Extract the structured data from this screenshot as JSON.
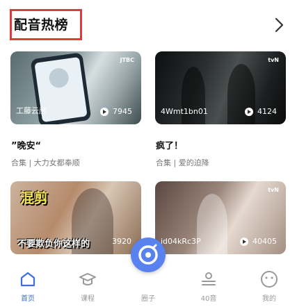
{
  "section": {
    "title": "配音热榜"
  },
  "cards": [
    {
      "label": "工藤云彦",
      "count": "7945",
      "tag": "JTBC",
      "name": "”晚安“",
      "sub": "合集 | 大力女都奉顺"
    },
    {
      "label": "4Wmt1bn01",
      "count": "4124",
      "tag": "tvN",
      "name": "疯了！",
      "sub": "合集 | 爱的迫降"
    },
    {
      "label": "",
      "count": "3920",
      "overlay_top": "混剪",
      "overlay_bottom": "不要欺负你这样的",
      "tag": ""
    },
    {
      "label": "id04kRc3P",
      "count": "40405",
      "tag": "tvN"
    }
  ],
  "tabs": [
    {
      "label": "首页",
      "active": true
    },
    {
      "label": "课程"
    },
    {
      "label": "圈子"
    },
    {
      "label": "40音"
    },
    {
      "label": "我的"
    }
  ],
  "colors": {
    "accent": "#3f6be0",
    "highlight_box": "#e03a3a"
  }
}
